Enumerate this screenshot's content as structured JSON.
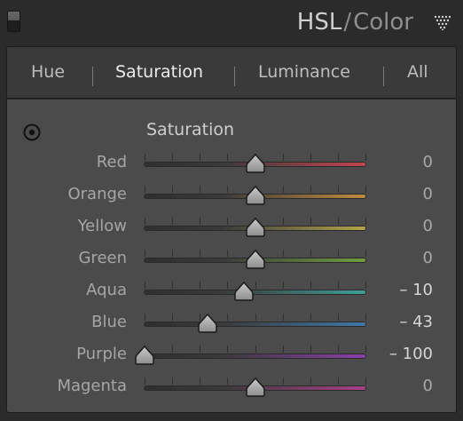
{
  "header": {
    "title_main": "HSL",
    "title_sep": "/",
    "title_secondary": "Color",
    "icons": {
      "collapse": "panel-collapse-toggle",
      "menu": "triangle-dropdown-icon"
    }
  },
  "tabs": [
    {
      "label": "Hue",
      "active": false
    },
    {
      "label": "Saturation",
      "active": true
    },
    {
      "label": "Luminance",
      "active": false
    },
    {
      "label": "All",
      "active": false
    }
  ],
  "section": {
    "title": "Saturation",
    "adjust_icon": "target-adjustment-icon"
  },
  "slider_range": [
    -100,
    100
  ],
  "sliders": [
    {
      "label": "Red",
      "value": 0,
      "display": "0",
      "color": "#c0454f"
    },
    {
      "label": "Orange",
      "value": 0,
      "display": "0",
      "color": "#c08a3e"
    },
    {
      "label": "Yellow",
      "value": 0,
      "display": "0",
      "color": "#b3a44b"
    },
    {
      "label": "Green",
      "value": 0,
      "display": "0",
      "color": "#6f9e40"
    },
    {
      "label": "Aqua",
      "value": -10,
      "display": "– 10",
      "color": "#3f9e96"
    },
    {
      "label": "Blue",
      "value": -43,
      "display": "– 43",
      "color": "#3f78a8"
    },
    {
      "label": "Purple",
      "value": -100,
      "display": "– 100",
      "color": "#8a3fa8"
    },
    {
      "label": "Magenta",
      "value": 0,
      "display": "0",
      "color": "#a83f88"
    }
  ],
  "colors": {
    "background": "#2b2b2b",
    "panel": "#4b4b4b",
    "tabbar": "#3a3a3a"
  }
}
